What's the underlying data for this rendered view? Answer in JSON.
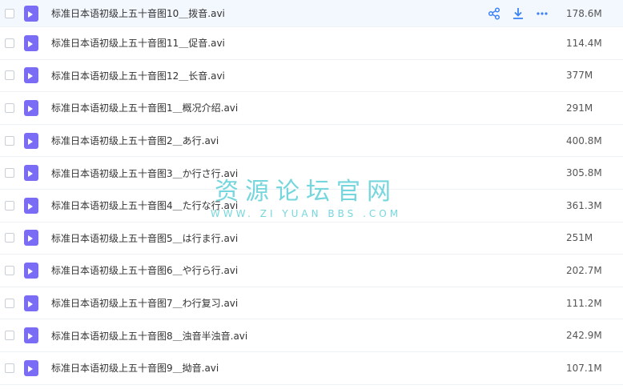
{
  "files": [
    {
      "name": "标准日本语初级上五十音图10＿拨音.avi",
      "size": "178.6M"
    },
    {
      "name": "标准日本语初级上五十音图11＿促音.avi",
      "size": "114.4M"
    },
    {
      "name": "标准日本语初级上五十音图12＿长音.avi",
      "size": "377M"
    },
    {
      "name": "标准日本语初级上五十音图1＿概况介绍.avi",
      "size": "291M"
    },
    {
      "name": "标准日本语初级上五十音图2＿あ行.avi",
      "size": "400.8M"
    },
    {
      "name": "标准日本语初级上五十音图3＿か行さ行.avi",
      "size": "305.8M"
    },
    {
      "name": "标准日本语初级上五十音图4＿た行な行.avi",
      "size": "361.3M"
    },
    {
      "name": "标准日本语初级上五十音图5＿は行ま行.avi",
      "size": "251M"
    },
    {
      "name": "标准日本语初级上五十音图6＿や行ら行.avi",
      "size": "202.7M"
    },
    {
      "name": "标准日本语初级上五十音图7＿わ行复习.avi",
      "size": "111.2M"
    },
    {
      "name": "标准日本语初级上五十音图8＿浊音半浊音.avi",
      "size": "242.9M"
    },
    {
      "name": "标准日本语初级上五十音图9＿拗音.avi",
      "size": "107.1M"
    }
  ],
  "row_actions": [
    "share-icon",
    "download-icon",
    "more-icon"
  ],
  "watermark": {
    "title": "资源论坛官网",
    "url": "WWW. ZI YUAN BBS .COM"
  },
  "colors": {
    "accent": "#3b82f6",
    "file_icon": "#7b6cf6",
    "hover_row": "#f3f7fe",
    "watermark": "#5fd0d8"
  }
}
